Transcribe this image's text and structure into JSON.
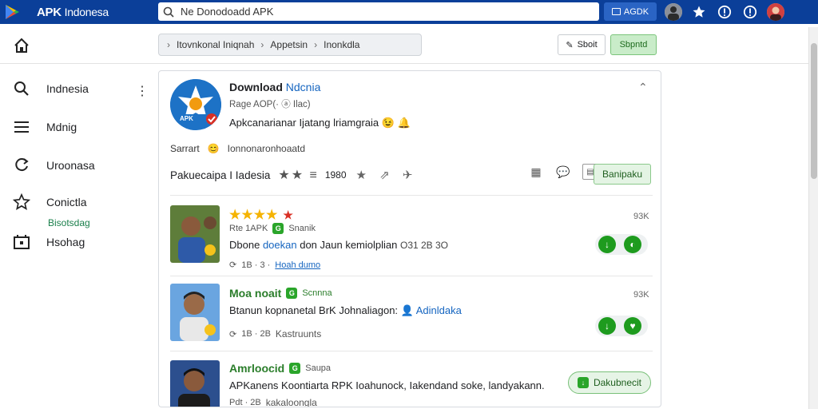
{
  "topbar": {
    "brand": "APK",
    "brand_suffix": "Indonesa",
    "search_value": "Ne Donodoadd APK",
    "promo_label": "AGDK",
    "icons": [
      "play-logo-icon",
      "search-icon",
      "person-icon",
      "star-icon",
      "info-icon",
      "info-icon",
      "profile-avatar"
    ]
  },
  "toolbar": {
    "crumbs": [
      "Itovnkonal Iniqnah",
      "Appetsin",
      "Inonkdla"
    ],
    "short_label": "Sboit",
    "submit_label": "Sbpntd"
  },
  "sidebar": {
    "items": [
      {
        "label": "Indnesia",
        "icon": "search-icon"
      },
      {
        "label": "Mdnig",
        "icon": "list-icon"
      },
      {
        "label": "Uroonasa",
        "icon": "refresh-icon"
      },
      {
        "label": "Conictla",
        "icon": "star-outline-icon"
      },
      {
        "label": "Hsohag",
        "icon": "media-icon"
      }
    ],
    "sub_label": "Bisotsdag"
  },
  "app": {
    "title": "Download",
    "title_accent": "Ndcnia",
    "meta": "Rage AOP(·  ⓐ  Ilac)",
    "description": "Apkcanarianar Ijatang lriamgraia",
    "share_label": "Sarrart",
    "share_text": "Ionnonaronhoaatd",
    "rating_label": "Pakuecaipa I Iadesia",
    "rating_count": "1980",
    "action_label": "Banipaku"
  },
  "reviews": [
    {
      "stars": "★★★★",
      "sub": "Rte 1APK",
      "badge": "Snanik",
      "text_a": "Dbone",
      "text_link": "doekan",
      "text_b": "don Jaun kemiolplian",
      "text_c": "O31 2B 3O",
      "meta_a": "1B · 3 ·",
      "meta_link": "Hoah dumo",
      "size": "93K"
    },
    {
      "head": "Moa noait",
      "badge": "Scnnna",
      "text_a": "Btanun kopnanetal BrK Johnaliagon:",
      "text_link": "Adinldaka",
      "meta_a": "1B · 2B",
      "meta_b": "Kastruunts",
      "size": "93K"
    },
    {
      "head": "Amrloocid",
      "badge": "Saupa",
      "text_a": "APKanens Koontiarta RPK Ioahunock,",
      "text_b": "Iakendand soke, landyakann.",
      "meta_a": "Pdt · 2B",
      "meta_b": "kakaloongla",
      "button": "Dakubnecit"
    }
  ],
  "colors": {
    "topbar": "#0b3f99",
    "accent_green": "#2aa52a",
    "link_blue": "#1565c0"
  }
}
